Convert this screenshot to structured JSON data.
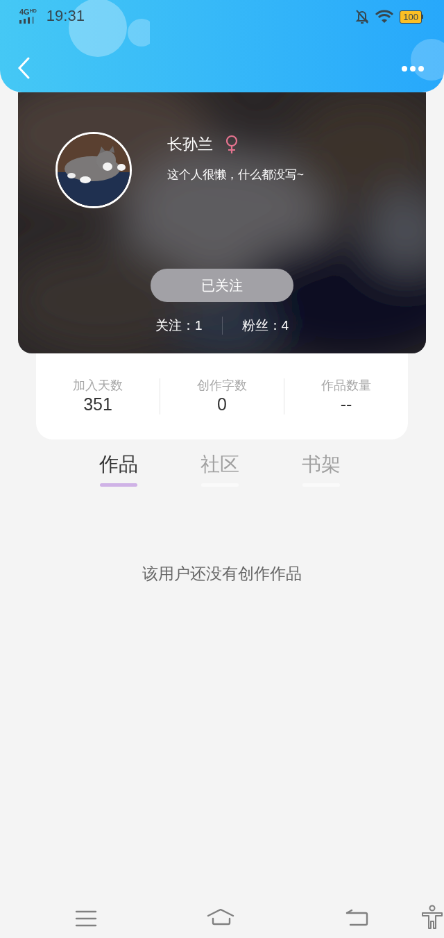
{
  "status_bar": {
    "network": "4G",
    "network_badge": "HD",
    "time": "19:31",
    "battery": "100"
  },
  "profile": {
    "name": "长孙兰",
    "female": true,
    "bio": "这个人很懒，什么都没写~",
    "follow_button": {
      "label": "已关注",
      "following": true
    },
    "counts": [
      {
        "label": "关注：1"
      },
      {
        "label": "粉丝：4"
      }
    ]
  },
  "stats": [
    {
      "label": "加入天数",
      "value": "351"
    },
    {
      "label": "创作字数",
      "value": "0"
    },
    {
      "label": "作品数量",
      "value": "--"
    }
  ],
  "tabs": [
    {
      "label": "作品",
      "selected": true
    },
    {
      "label": "社区",
      "selected": false
    },
    {
      "label": "书架",
      "selected": false
    }
  ],
  "empty_message": "该用户还没有创作作品"
}
